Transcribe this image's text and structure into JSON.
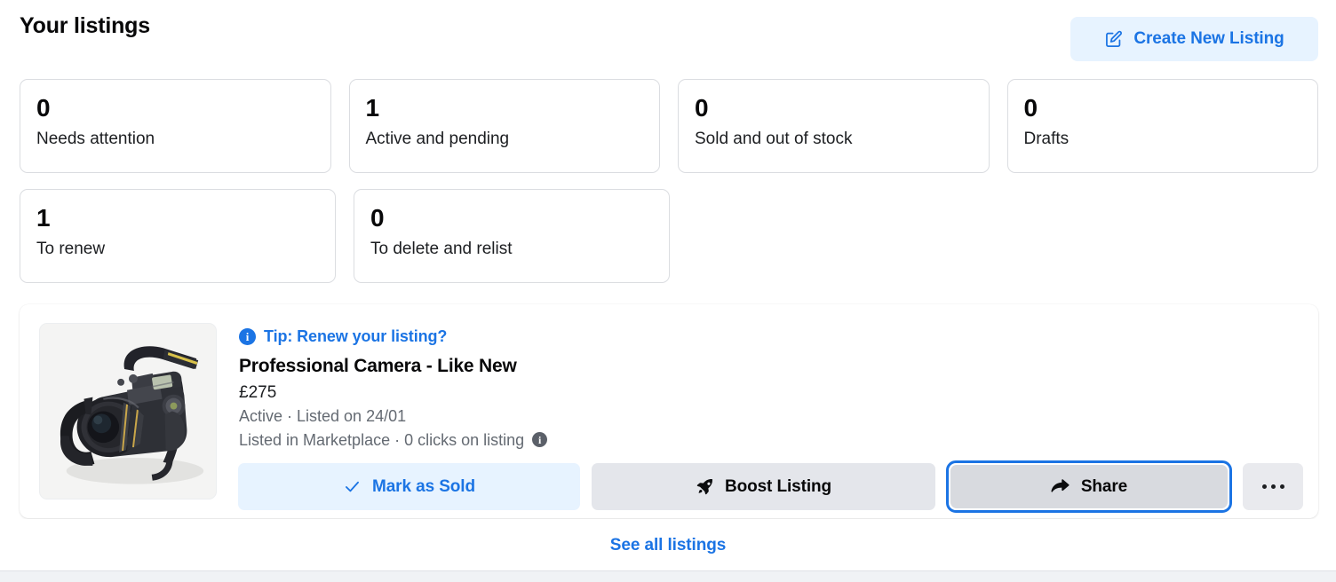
{
  "header": {
    "title": "Your listings",
    "create_button": {
      "label": "Create New Listing",
      "icon": "pencil-square-icon",
      "bg_color": "#e7f3ff",
      "text_color": "#1b74e4"
    }
  },
  "stats": {
    "row1": [
      {
        "count": "0",
        "label": "Needs attention"
      },
      {
        "count": "1",
        "label": "Active and pending"
      },
      {
        "count": "0",
        "label": "Sold and out of stock"
      },
      {
        "count": "0",
        "label": "Drafts"
      }
    ],
    "row2": [
      {
        "count": "1",
        "label": "To renew"
      },
      {
        "count": "0",
        "label": "To delete and relist"
      }
    ]
  },
  "listing": {
    "thumbnail_alt": "Professional DSLR camera with lens hood and neck strap on white background",
    "tip": {
      "icon": "info-icon",
      "text": "Tip: Renew your listing?",
      "color": "#1b74e4"
    },
    "title": "Professional Camera - Like New",
    "price": "£275",
    "status_line": "Active · Listed on 24/01",
    "reach_line": "Listed in Marketplace · 0 clicks on listing",
    "reach_info_icon": "info-icon",
    "actions": [
      {
        "label": "Mark as Sold",
        "icon": "check-icon",
        "style": "blue"
      },
      {
        "label": "Boost Listing",
        "icon": "rocket-icon",
        "style": "grey"
      },
      {
        "label": "Share",
        "icon": "share-arrow-icon",
        "style": "grey-focused",
        "focused": true
      },
      {
        "label": "",
        "icon": "ellipsis-icon",
        "style": "grey-light"
      }
    ]
  },
  "footer": {
    "see_all_label": "See all listings",
    "link_color": "#1b74e4"
  }
}
